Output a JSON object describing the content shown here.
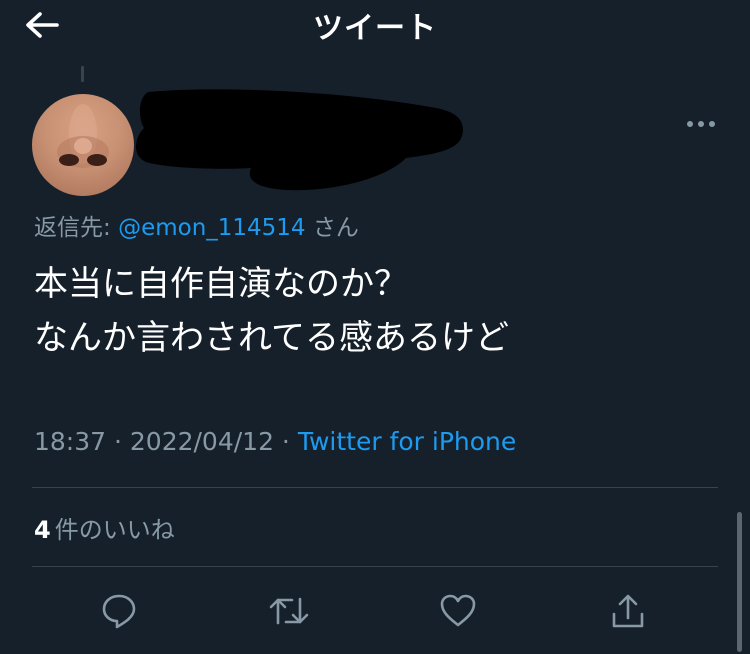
{
  "header": {
    "title": "ツイート",
    "back_icon": "arrow-left-icon"
  },
  "tweet": {
    "reply_prefix": "返信先: ",
    "reply_handle": "@emon_114514",
    "reply_suffix": " さん",
    "text_lines": [
      "本当に自作自演なのか？",
      "なんか言わされてる感あるけど"
    ],
    "time": "18:37",
    "separator": " · ",
    "date": "2022/04/12",
    "source": "Twitter for iPhone"
  },
  "likes": {
    "count": "4",
    "label": "件のいいね"
  },
  "actions": [
    {
      "name": "reply",
      "icon": "reply-icon"
    },
    {
      "name": "retweet",
      "icon": "retweet-icon"
    },
    {
      "name": "like",
      "icon": "heart-icon"
    },
    {
      "name": "share",
      "icon": "share-icon"
    }
  ],
  "colors": {
    "background": "#15202b",
    "text": "#ffffff",
    "secondary": "#8899a6",
    "accent": "#1d9bf0",
    "divider": "#38444d"
  }
}
